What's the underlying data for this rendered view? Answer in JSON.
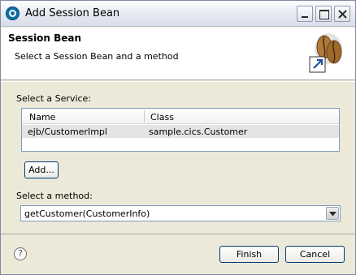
{
  "window": {
    "title": "Add Session Bean",
    "controls": {
      "minimize_icon": "minimize-icon",
      "maximize_icon": "maximize-icon",
      "close_icon": "close-icon"
    }
  },
  "header": {
    "title": "Session Bean",
    "description": "Select a Session Bean and a method",
    "banner_icon": "coffee-bean-icon"
  },
  "service": {
    "label": "Select a Service:",
    "columns": [
      "Name",
      "Class"
    ],
    "rows": [
      {
        "name": "ejb/CustomerImpl",
        "class": "sample.cics.Customer"
      }
    ],
    "add_label": "Add..."
  },
  "method": {
    "label": "Select a method:",
    "selected": "getCustomer(CustomerInfo)"
  },
  "footer": {
    "help_icon": "help-icon",
    "help_glyph": "?",
    "finish_label": "Finish",
    "cancel_label": "Cancel"
  },
  "colors": {
    "dialog_bg": "#ece9d8",
    "header_bg": "#ffffff",
    "selected_row": "#e4e4e4",
    "button_border": "#003c74"
  }
}
